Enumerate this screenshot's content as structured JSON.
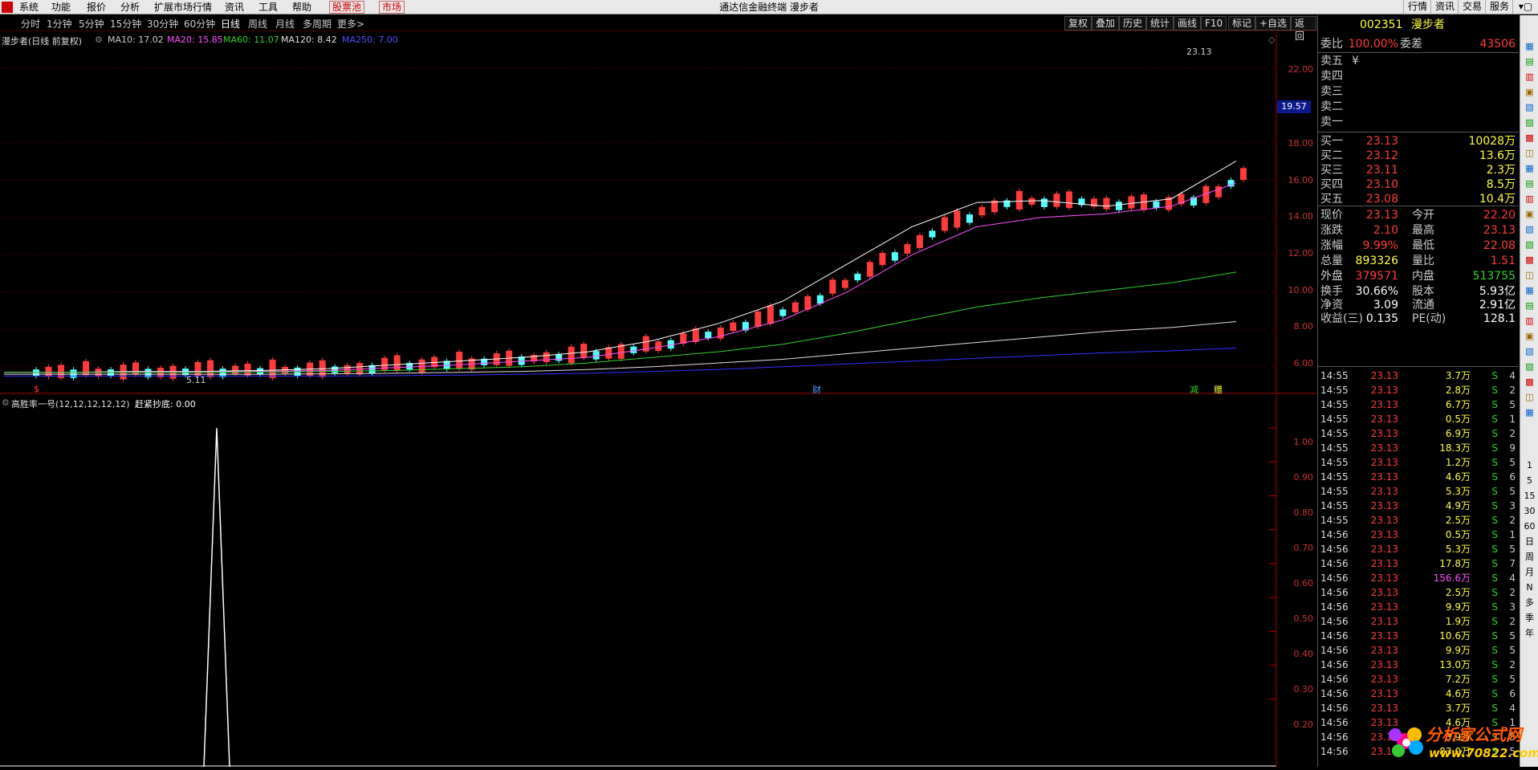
{
  "menu": {
    "items": [
      "系统",
      "功能",
      "报价",
      "分析",
      "扩展市场行情",
      "资讯",
      "工具",
      "帮助"
    ],
    "highlight1": "股票池",
    "highlight2": "市场",
    "window_title": "通达信金融终端  漫步者",
    "right": [
      "行情",
      "资讯",
      "交易",
      "服务"
    ]
  },
  "periods": {
    "items": [
      "分时",
      "1分钟",
      "5分钟",
      "15分钟",
      "30分钟",
      "60分钟",
      "日线",
      "周线",
      "月线",
      "多周期",
      "更多>"
    ],
    "selected": "日线"
  },
  "tools": [
    "复权",
    "叠加",
    "历史",
    "统计",
    "画线",
    "F10",
    "标记",
    "+自选",
    "返回"
  ],
  "kline": {
    "legend_name": "漫步者(日线 前复权)",
    "ma": [
      {
        "label": "MA10: 17.02",
        "color": "#ffffff"
      },
      {
        "label": "MA20: 15.85",
        "color": "#ff4fff"
      },
      {
        "label": "MA60: 11.07",
        "color": "#2fd22f"
      },
      {
        "label": "MA120: 8.42",
        "color": "#e0e0e0"
      },
      {
        "label": "MA250: 7.00",
        "color": "#3030ff"
      }
    ],
    "y_ticks": [
      "22.00",
      "18.00",
      "16.00",
      "14.00",
      "12.00",
      "10.00",
      "8.00",
      "6.00"
    ],
    "price_tag": "19.57",
    "high_label": "23.13",
    "low_label": "5.11",
    "markers": [
      "$",
      "财",
      "减",
      "赠"
    ]
  },
  "indicator": {
    "legend": "高胜率一号(12,12,12,12,12)",
    "value": "赶紧抄底: 0.00",
    "y_ticks": [
      "1.00",
      "0.90",
      "0.80",
      "0.70",
      "0.60",
      "0.50",
      "0.40",
      "0.30",
      "0.20"
    ]
  },
  "chart_data": [
    {
      "type": "line",
      "name": "MA curves",
      "series": [
        {
          "name": "MA10",
          "values": [
            5.7,
            5.7,
            5.75,
            5.75,
            5.8,
            5.9,
            6.1,
            6.3,
            6.5,
            6.8,
            7.4,
            8.3,
            9.5,
            11.5,
            13.5,
            14.8,
            14.9,
            14.6,
            15.0,
            17.02
          ]
        },
        {
          "name": "MA20",
          "values": [
            5.7,
            5.7,
            5.72,
            5.72,
            5.75,
            5.8,
            5.95,
            6.1,
            6.3,
            6.5,
            7.0,
            7.6,
            8.5,
            10.0,
            12.0,
            13.5,
            14.0,
            14.2,
            14.6,
            15.85
          ]
        },
        {
          "name": "MA60",
          "values": [
            5.7,
            5.7,
            5.7,
            5.7,
            5.72,
            5.75,
            5.8,
            5.9,
            6.0,
            6.2,
            6.5,
            6.8,
            7.2,
            7.8,
            8.5,
            9.2,
            9.7,
            10.1,
            10.5,
            11.07
          ]
        },
        {
          "name": "MA120",
          "values": [
            5.6,
            5.6,
            5.6,
            5.6,
            5.6,
            5.62,
            5.65,
            5.7,
            5.75,
            5.85,
            6.0,
            6.2,
            6.4,
            6.7,
            7.0,
            7.3,
            7.6,
            7.9,
            8.1,
            8.42
          ]
        },
        {
          "name": "MA250",
          "values": [
            5.5,
            5.5,
            5.5,
            5.5,
            5.5,
            5.5,
            5.52,
            5.55,
            5.6,
            5.65,
            5.75,
            5.85,
            6.0,
            6.15,
            6.3,
            6.45,
            6.6,
            6.75,
            6.85,
            7.0
          ]
        }
      ],
      "ylim": [
        5.0,
        23.5
      ]
    },
    {
      "type": "line",
      "name": "高胜率一号",
      "x": [
        0,
        1,
        2,
        3,
        4,
        5,
        6,
        7,
        8,
        9,
        10,
        11,
        12,
        13,
        14,
        15,
        16,
        17,
        18,
        19
      ],
      "values": [
        0,
        0,
        0,
        0,
        0,
        0,
        0,
        0,
        1.0,
        0,
        0,
        0,
        0,
        0,
        0,
        0,
        0,
        0,
        0,
        0
      ],
      "ylim": [
        0,
        1.05
      ]
    }
  ],
  "quote": {
    "code": "002351",
    "name": "漫步者",
    "weibi_label": "委比",
    "weibi": "100.00%",
    "weicha_label": "委差",
    "weicha": "43506",
    "sells": [
      {
        "label": "卖五",
        "price": "¥",
        "vol": ""
      },
      {
        "label": "卖四",
        "price": "",
        "vol": ""
      },
      {
        "label": "卖三",
        "price": "",
        "vol": ""
      },
      {
        "label": "卖二",
        "price": "",
        "vol": ""
      },
      {
        "label": "卖一",
        "price": "",
        "vol": ""
      }
    ],
    "buys": [
      {
        "label": "买一",
        "price": "23.13",
        "vol": "10028万"
      },
      {
        "label": "买二",
        "price": "23.12",
        "vol": "13.6万"
      },
      {
        "label": "买三",
        "price": "23.11",
        "vol": "2.3万"
      },
      {
        "label": "买四",
        "price": "23.10",
        "vol": "8.5万"
      },
      {
        "label": "买五",
        "price": "23.08",
        "vol": "10.4万"
      }
    ],
    "stats": [
      {
        "l1": "现价",
        "v1": "23.13",
        "c1": "red",
        "l2": "今开",
        "v2": "22.20",
        "c2": "red"
      },
      {
        "l1": "涨跌",
        "v1": "2.10",
        "c1": "red",
        "l2": "最高",
        "v2": "23.13",
        "c2": "red"
      },
      {
        "l1": "涨幅",
        "v1": "9.99%",
        "c1": "red",
        "l2": "最低",
        "v2": "22.08",
        "c2": "red"
      },
      {
        "l1": "总量",
        "v1": "893326",
        "c1": "yel",
        "l2": "量比",
        "v2": "1.51",
        "c2": "red"
      },
      {
        "l1": "外盘",
        "v1": "379571",
        "c1": "red",
        "l2": "内盘",
        "v2": "513755",
        "c2": "grn"
      },
      {
        "l1": "换手",
        "v1": "30.66%",
        "c1": "wht",
        "l2": "股本",
        "v2": "5.93亿",
        "c2": "wht"
      },
      {
        "l1": "净资",
        "v1": "3.09",
        "c1": "wht",
        "l2": "流通",
        "v2": "2.91亿",
        "c2": "wht"
      },
      {
        "l1": "收益(三)",
        "v1": "0.135",
        "c1": "wht",
        "l2": "PE(动)",
        "v2": "128.1",
        "c2": "wht"
      }
    ],
    "ticks": [
      {
        "t": "14:55",
        "p": "23.13",
        "v": "3.7万",
        "s": "S",
        "n": "4"
      },
      {
        "t": "14:55",
        "p": "23.13",
        "v": "2.8万",
        "s": "S",
        "n": "2"
      },
      {
        "t": "14:55",
        "p": "23.13",
        "v": "6.7万",
        "s": "S",
        "n": "5"
      },
      {
        "t": "14:55",
        "p": "23.13",
        "v": "0.5万",
        "s": "S",
        "n": "1"
      },
      {
        "t": "14:55",
        "p": "23.13",
        "v": "6.9万",
        "s": "S",
        "n": "2"
      },
      {
        "t": "14:55",
        "p": "23.13",
        "v": "18.3万",
        "s": "S",
        "n": "9"
      },
      {
        "t": "14:55",
        "p": "23.13",
        "v": "1.2万",
        "s": "S",
        "n": "5"
      },
      {
        "t": "14:55",
        "p": "23.13",
        "v": "4.6万",
        "s": "S",
        "n": "6"
      },
      {
        "t": "14:55",
        "p": "23.13",
        "v": "5.3万",
        "s": "S",
        "n": "5"
      },
      {
        "t": "14:55",
        "p": "23.13",
        "v": "4.9万",
        "s": "S",
        "n": "3"
      },
      {
        "t": "14:55",
        "p": "23.13",
        "v": "2.5万",
        "s": "S",
        "n": "2"
      },
      {
        "t": "14:56",
        "p": "23.13",
        "v": "0.5万",
        "s": "S",
        "n": "1"
      },
      {
        "t": "14:56",
        "p": "23.13",
        "v": "5.3万",
        "s": "S",
        "n": "5"
      },
      {
        "t": "14:56",
        "p": "23.13",
        "v": "17.8万",
        "s": "S",
        "n": "7"
      },
      {
        "t": "14:56",
        "p": "23.13",
        "v": "156.6万",
        "s": "S",
        "n": "4"
      },
      {
        "t": "14:56",
        "p": "23.13",
        "v": "2.5万",
        "s": "S",
        "n": "2"
      },
      {
        "t": "14:56",
        "p": "23.13",
        "v": "9.9万",
        "s": "S",
        "n": "3"
      },
      {
        "t": "14:56",
        "p": "23.13",
        "v": "1.9万",
        "s": "S",
        "n": "2"
      },
      {
        "t": "14:56",
        "p": "23.13",
        "v": "10.6万",
        "s": "S",
        "n": "5"
      },
      {
        "t": "14:56",
        "p": "23.13",
        "v": "9.9万",
        "s": "S",
        "n": "5"
      },
      {
        "t": "14:56",
        "p": "23.13",
        "v": "13.0万",
        "s": "S",
        "n": "2"
      },
      {
        "t": "14:56",
        "p": "23.13",
        "v": "7.2万",
        "s": "S",
        "n": "5"
      },
      {
        "t": "14:56",
        "p": "23.13",
        "v": "4.6万",
        "s": "S",
        "n": "6"
      },
      {
        "t": "14:56",
        "p": "23.13",
        "v": "3.7万",
        "s": "S",
        "n": "4"
      },
      {
        "t": "14:56",
        "p": "23.13",
        "v": "4.6万",
        "s": "S",
        "n": "1"
      },
      {
        "t": "14:56",
        "p": "23.13",
        "v": "3.9万",
        "s": "S",
        "n": "5"
      },
      {
        "t": "14:56",
        "p": "23.13",
        "v": "83.0万",
        "s": "S",
        "n": "5"
      }
    ]
  },
  "rtools": [
    "1",
    "5",
    "15",
    "30",
    "60",
    "日",
    "周",
    "月",
    "N",
    "多",
    "季",
    "年"
  ],
  "watermark": {
    "line1": "分析家公式网",
    "line2": "www.70822.com"
  }
}
